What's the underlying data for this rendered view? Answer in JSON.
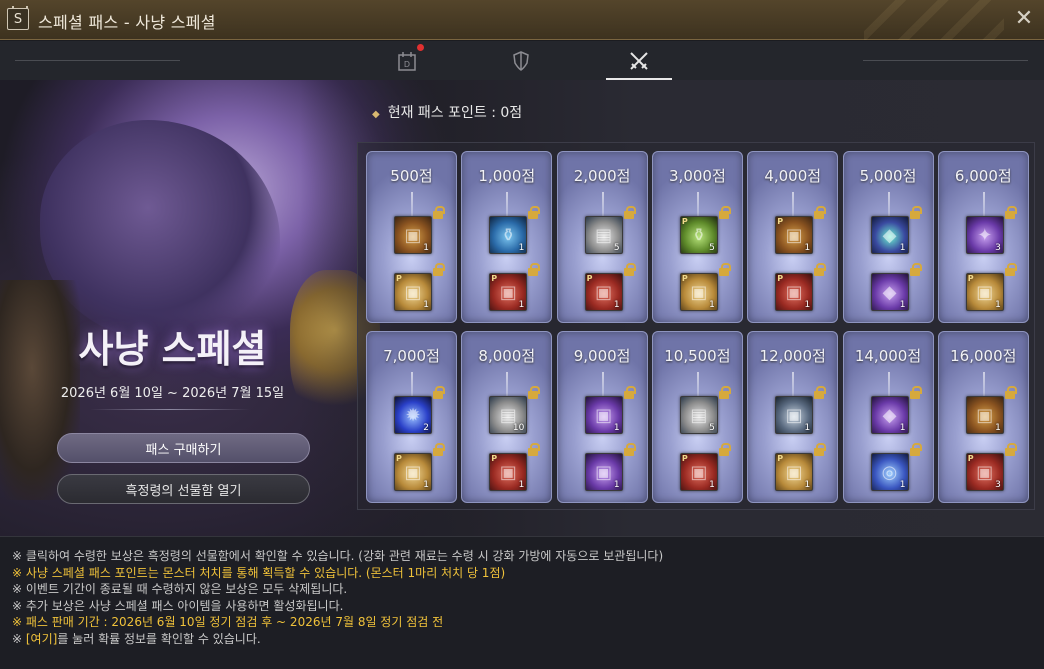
{
  "window": {
    "icon_letter": "S",
    "title": "스페셜 패스 - 사냥 스페셜",
    "close_glyph": "✕"
  },
  "tabs": [
    {
      "name": "daily-tab",
      "icon": "calendar-icon",
      "badge": true,
      "active": false
    },
    {
      "name": "shield-tab",
      "icon": "shield-sword-icon",
      "badge": false,
      "active": false
    },
    {
      "name": "hunting-tab",
      "icon": "crossed-swords-icon",
      "badge": false,
      "active": true
    }
  ],
  "event": {
    "title": "사냥 스페셜",
    "date_range": "2026년 6월 10일 ~ 2026년 7월 15일",
    "buy_button": "패스 구매하기",
    "gift_button": "흑정령의 선물함 열기"
  },
  "current_points": "현재 패스 포인트 : 0점",
  "rewards": [
    {
      "points": "500점",
      "free": {
        "icon": "treasure-chest-icon",
        "color": "chest",
        "count": "1",
        "p": false
      },
      "paid": {
        "icon": "gold-chest-icon",
        "color": "gold",
        "count": "1",
        "p": true
      }
    },
    {
      "points": "1,000점",
      "free": {
        "icon": "potion-bottle-icon",
        "color": "blue",
        "count": "1",
        "p": false
      },
      "paid": {
        "icon": "red-chest-icon",
        "color": "red",
        "count": "1",
        "p": true
      }
    },
    {
      "points": "2,000점",
      "free": {
        "icon": "scroll-icon",
        "color": "scroll",
        "count": "5",
        "p": false
      },
      "paid": {
        "icon": "red-chest-icon",
        "color": "red",
        "count": "1",
        "p": true
      }
    },
    {
      "points": "3,000점",
      "free": {
        "icon": "green-potion-icon",
        "color": "green",
        "count": "5",
        "p": true
      },
      "paid": {
        "icon": "gold-chest-icon",
        "color": "gold",
        "count": "1",
        "p": true
      }
    },
    {
      "points": "4,000점",
      "free": {
        "icon": "treasure-chest-icon",
        "color": "chest",
        "count": "1",
        "p": true
      },
      "paid": {
        "icon": "red-chest-icon",
        "color": "red",
        "count": "1",
        "p": true
      }
    },
    {
      "points": "5,000점",
      "free": {
        "icon": "crystal-cube-icon",
        "color": "teal",
        "count": "1",
        "p": false
      },
      "paid": {
        "icon": "purple-cube-icon",
        "color": "purple",
        "count": "1",
        "p": false
      }
    },
    {
      "points": "6,000점",
      "free": {
        "icon": "magic-tome-icon",
        "color": "purple",
        "count": "3",
        "p": false
      },
      "paid": {
        "icon": "gold-chest-icon",
        "color": "gold",
        "count": "1",
        "p": true
      }
    },
    {
      "points": "7,000점",
      "free": {
        "icon": "blue-flame-icon",
        "color": "orb",
        "count": "2",
        "p": false
      },
      "paid": {
        "icon": "gold-chest-icon",
        "color": "gold",
        "count": "1",
        "p": true
      }
    },
    {
      "points": "8,000점",
      "free": {
        "icon": "scroll-icon",
        "color": "scroll",
        "count": "10",
        "p": false
      },
      "paid": {
        "icon": "red-chest-icon",
        "color": "red",
        "count": "1",
        "p": true
      }
    },
    {
      "points": "9,000점",
      "free": {
        "icon": "purple-chest-icon",
        "color": "purple",
        "count": "1",
        "p": false
      },
      "paid": {
        "icon": "purple-chest-icon",
        "color": "purple",
        "count": "1",
        "p": false
      }
    },
    {
      "points": "10,500점",
      "free": {
        "icon": "scroll-icon",
        "color": "scroll",
        "count": "5",
        "p": false
      },
      "paid": {
        "icon": "red-chest-icon",
        "color": "red",
        "count": "1",
        "p": true
      }
    },
    {
      "points": "12,000점",
      "free": {
        "icon": "silver-chest-icon",
        "color": "silver",
        "count": "1",
        "p": false
      },
      "paid": {
        "icon": "gold-chest-icon",
        "color": "gold",
        "count": "1",
        "p": true
      }
    },
    {
      "points": "14,000점",
      "free": {
        "icon": "purple-cube-icon",
        "color": "purple",
        "count": "1",
        "p": false
      },
      "paid": {
        "icon": "magic-circle-icon",
        "color": "magic",
        "count": "1",
        "p": false
      }
    },
    {
      "points": "16,000점",
      "free": {
        "icon": "treasure-chest-icon",
        "color": "chest",
        "count": "1",
        "p": false
      },
      "paid": {
        "icon": "red-chest-icon",
        "color": "red",
        "count": "3",
        "p": true
      }
    }
  ],
  "p_label": "P",
  "notes": [
    {
      "text": "※ 클릭하여 수령한 보상은 흑정령의 선물함에서 확인할 수 있습니다. (강화 관련 재료는 수령 시 강화 가방에 자동으로 보관됩니다)",
      "highlight": false
    },
    {
      "text": "※ 사냥 스페셜 패스 포인트는 몬스터 처치를 통해 획득할 수 있습니다. (몬스터 1마리 처치 당 1점)",
      "highlight": true
    },
    {
      "text": "※ 이벤트 기간이 종료될 때 수령하지 않은 보상은 모두 삭제됩니다.",
      "highlight": false
    },
    {
      "text": "※ 추가 보상은 사냥 스페셜 패스 아이템을 사용하면 활성화됩니다.",
      "highlight": false
    },
    {
      "text": "※ 패스 판매 기간 : 2026년 6월 10일 정기 점검 후 ~ 2026년 7월 8일 정기 점검 전",
      "highlight": true
    }
  ],
  "last_note": {
    "prefix": "※ ",
    "link": "[여기]",
    "suffix": "를 눌러 확률 정보를 확인할 수 있습니다."
  },
  "colors": {
    "accent_gold": "#f0c23a",
    "title_bar": "#4a3d27",
    "card_blue": "#9aa0d0",
    "lock_gold": "#d6a93d"
  }
}
